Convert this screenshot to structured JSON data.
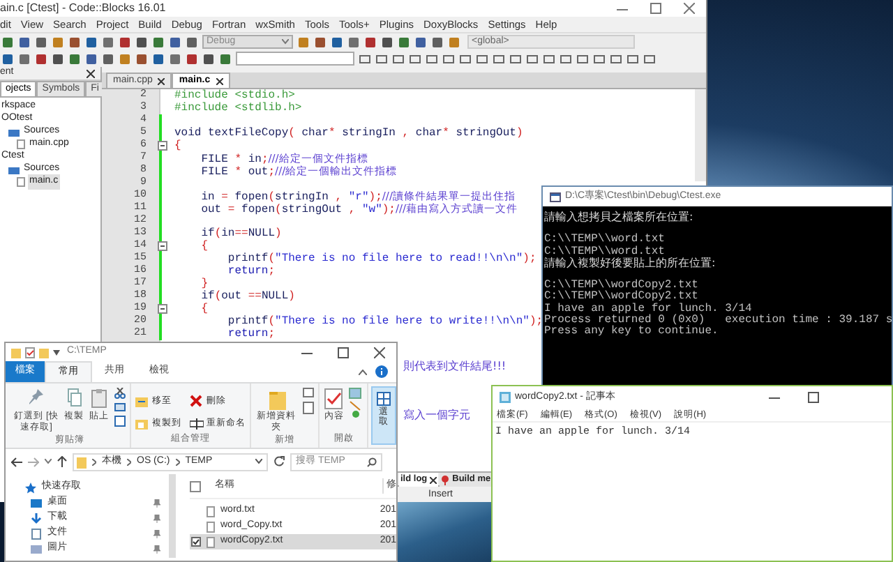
{
  "code_blocks": {
    "title": "ain.c [Ctest] - Code::Blocks 16.01",
    "menu": [
      "dit",
      "View",
      "Search",
      "Project",
      "Build",
      "Debug",
      "Fortran",
      "wxSmith",
      "Tools",
      "Tools+",
      "Plugins",
      "DoxyBlocks",
      "Settings",
      "Help"
    ],
    "build_target": "Debug",
    "scope": "<global>",
    "management": {
      "title": "ent",
      "tabs": [
        {
          "label": "ojects",
          "selected": true
        },
        {
          "label": "Symbols",
          "selected": false
        },
        {
          "label": "Fi",
          "selected": false
        }
      ],
      "tree": [
        {
          "label": "rkspace",
          "children": [
            {
              "label": "OOtest",
              "children": [
                {
                  "label": "Sources",
                  "kind": "folder",
                  "children": [
                    {
                      "label": "main.cpp",
                      "kind": "file",
                      "selected": false
                    }
                  ]
                }
              ]
            },
            {
              "label": "Ctest",
              "children": [
                {
                  "label": "Sources",
                  "kind": "folder",
                  "children": [
                    {
                      "label": "main.c",
                      "kind": "file",
                      "selected": true
                    }
                  ]
                }
              ]
            }
          ]
        }
      ]
    },
    "editor": {
      "tabs": [
        {
          "label": "main.cpp",
          "selected": false
        },
        {
          "label": "main.c",
          "selected": true
        }
      ],
      "lines": [
        {
          "number": "2",
          "fold": false,
          "segments": [
            {
              "kind": "pre",
              "text": "#include <stdio.h>"
            }
          ]
        },
        {
          "number": "3",
          "fold": false,
          "segments": [
            {
              "kind": "pre",
              "text": "#include <stdlib.h>"
            }
          ]
        },
        {
          "number": "4",
          "fold": false
        },
        {
          "number": "5",
          "fold": false,
          "segments": [
            {
              "kind": "code",
              "text": "void textFileCopy"
            },
            {
              "kind": "op",
              "text": "("
            },
            {
              "kind": "code",
              "text": " char"
            },
            {
              "kind": "op",
              "text": "*"
            },
            {
              "kind": "code",
              "text": " stringIn "
            },
            {
              "kind": "op",
              "text": ","
            },
            {
              "kind": "code",
              "text": " char"
            },
            {
              "kind": "op",
              "text": "*"
            },
            {
              "kind": "code",
              "text": " stringOut"
            },
            {
              "kind": "op",
              "text": ")"
            }
          ]
        },
        {
          "number": "6",
          "fold": true,
          "segments": [
            {
              "kind": "op",
              "text": "{"
            }
          ]
        },
        {
          "number": "7",
          "fold": false,
          "segments": [
            {
              "kind": "code",
              "text": "    FILE "
            },
            {
              "kind": "op",
              "text": "*"
            },
            {
              "kind": "code",
              "text": " in"
            },
            {
              "kind": "op",
              "text": ";"
            },
            {
              "kind": "cmt",
              "text": "///給定一個文件指標"
            }
          ]
        },
        {
          "number": "8",
          "fold": false,
          "segments": [
            {
              "kind": "code",
              "text": "    FILE "
            },
            {
              "kind": "op",
              "text": "*"
            },
            {
              "kind": "code",
              "text": " out"
            },
            {
              "kind": "op",
              "text": ";"
            },
            {
              "kind": "cmt",
              "text": "///給定一個輸出文件指標"
            }
          ]
        },
        {
          "number": "9",
          "fold": false
        },
        {
          "number": "10",
          "fold": false,
          "segments": [
            {
              "kind": "code",
              "text": "    in "
            },
            {
              "kind": "op",
              "text": "="
            },
            {
              "kind": "code",
              "text": " fopen"
            },
            {
              "kind": "op",
              "text": "("
            },
            {
              "kind": "code",
              "text": "stringIn "
            },
            {
              "kind": "op",
              "text": ","
            },
            {
              "kind": "str",
              "text": " \"r\""
            },
            {
              "kind": "op",
              "text": ");"
            },
            {
              "kind": "cmt",
              "text": "///讀條件結果單一提出住指"
            }
          ]
        },
        {
          "number": "11",
          "fold": false,
          "segments": [
            {
              "kind": "code",
              "text": "    out "
            },
            {
              "kind": "op",
              "text": "="
            },
            {
              "kind": "code",
              "text": " fopen"
            },
            {
              "kind": "op",
              "text": "("
            },
            {
              "kind": "code",
              "text": "stringOut "
            },
            {
              "kind": "op",
              "text": ","
            },
            {
              "kind": "str",
              "text": " \"w\""
            },
            {
              "kind": "op",
              "text": ");"
            },
            {
              "kind": "cmt",
              "text": "///藉由寫入方式讀一文件"
            }
          ]
        },
        {
          "number": "12",
          "fold": false
        },
        {
          "number": "13",
          "fold": false,
          "segments": [
            {
              "kind": "code",
              "text": "    if"
            },
            {
              "kind": "op",
              "text": "("
            },
            {
              "kind": "code",
              "text": "in"
            },
            {
              "kind": "op",
              "text": "=="
            },
            {
              "kind": "code",
              "text": "NULL"
            },
            {
              "kind": "op",
              "text": ")"
            }
          ]
        },
        {
          "number": "14",
          "fold": true,
          "segments": [
            {
              "kind": "op",
              "text": "    {"
            }
          ]
        },
        {
          "number": "15",
          "fold": false,
          "segments": [
            {
              "kind": "code",
              "text": "        printf"
            },
            {
              "kind": "op",
              "text": "("
            },
            {
              "kind": "str",
              "text": "\"There is no file here to read!!\\n\\n\""
            },
            {
              "kind": "op",
              "text": ");"
            }
          ]
        },
        {
          "number": "16",
          "fold": false,
          "segments": [
            {
              "kind": "kw",
              "text": "        return"
            },
            {
              "kind": "op",
              "text": ";"
            }
          ]
        },
        {
          "number": "17",
          "fold": false,
          "segments": [
            {
              "kind": "op",
              "text": "    }"
            }
          ]
        },
        {
          "number": "18",
          "fold": false,
          "segments": [
            {
              "kind": "code",
              "text": "    if"
            },
            {
              "kind": "op",
              "text": "("
            },
            {
              "kind": "code",
              "text": "out "
            },
            {
              "kind": "op",
              "text": "=="
            },
            {
              "kind": "code",
              "text": "NULL"
            },
            {
              "kind": "op",
              "text": ")"
            }
          ]
        },
        {
          "number": "19",
          "fold": true,
          "segments": [
            {
              "kind": "op",
              "text": "    {"
            }
          ]
        },
        {
          "number": "20",
          "fold": false,
          "segments": [
            {
              "kind": "code",
              "text": "        printf"
            },
            {
              "kind": "op",
              "text": "("
            },
            {
              "kind": "str",
              "text": "\"There is no file here to write!!\\n\\n\""
            },
            {
              "kind": "op",
              "text": ");"
            }
          ]
        },
        {
          "number": "21",
          "fold": false,
          "segments": [
            {
              "kind": "kw",
              "text": "        return"
            },
            {
              "kind": "op",
              "text": ";"
            }
          ]
        }
      ],
      "fragments": [
        "則代表到文件結尾!!!",
        "寫入一個字元"
      ]
    },
    "log_tabs": [
      {
        "label": "ild log",
        "selected": true
      },
      {
        "label": "Build me",
        "selected": false
      }
    ],
    "status": "Insert"
  },
  "console": {
    "title": "D:\\C專案\\Ctest\\bin\\Debug\\Ctest.exe",
    "blocks": [
      [
        "請輸入想拷貝之檔案所在位置:"
      ],
      [
        "C:\\\\TEMP\\\\word.txt",
        "C:\\\\TEMP\\\\word.txt",
        "請輸入複製好後要貼上的所在位置:"
      ],
      [
        "C:\\\\TEMP\\\\wordCopy2.txt",
        "C:\\\\TEMP\\\\wordCopy2.txt",
        "I have an apple for lunch. 3/14",
        "Process returned 0 (0x0)   execution time : 39.187 s",
        "Press any key to continue."
      ]
    ]
  },
  "explorer": {
    "title": "C:\\TEMP",
    "tabs": [
      {
        "label": "檔案",
        "kind": "file"
      },
      {
        "label": "常用",
        "kind": "tab",
        "selected": true
      },
      {
        "label": "共用",
        "kind": "tab",
        "selected": false
      },
      {
        "label": "檢視",
        "kind": "tab",
        "selected": false
      }
    ],
    "groups": [
      {
        "label": "剪貼簿",
        "buttons": [
          {
            "label": "釘選到 [快速存取]",
            "kind": "pin"
          },
          {
            "label": "複製",
            "kind": "copy"
          },
          {
            "label": "貼上",
            "kind": "paste"
          }
        ]
      },
      {
        "label": "組合管理",
        "buttons": [
          {
            "label": "移至",
            "kind": "move"
          },
          {
            "label": "複製到",
            "kind": "copyto"
          },
          {
            "label": "刪除",
            "kind": "delete"
          },
          {
            "label": "重新命名",
            "kind": "rename"
          }
        ]
      },
      {
        "label": "新增",
        "buttons": [
          {
            "label": "新增資料夾",
            "kind": "folder"
          }
        ]
      },
      {
        "label": "開啟",
        "buttons": [
          {
            "label": "內容",
            "kind": "props"
          }
        ]
      }
    ],
    "select_button": "選取",
    "path": [
      "本機",
      "OS (C:)",
      "TEMP"
    ],
    "search_placeholder": "搜尋 TEMP",
    "nav": [
      "快速存取",
      "桌面",
      "下載",
      "文件",
      "圖片"
    ],
    "all_selected": false,
    "columns": [
      "名稱",
      "修"
    ],
    "files": [
      {
        "name": "word.txt",
        "date": "201",
        "selected": false
      },
      {
        "name": "word_Copy.txt",
        "date": "201",
        "selected": false
      },
      {
        "name": "wordCopy2.txt",
        "date": "201",
        "selected": true
      }
    ]
  },
  "notepad": {
    "title": "wordCopy2.txt - 記事本",
    "menu": [
      "檔案(F)",
      "編輯(E)",
      "格式(O)",
      "檢視(V)",
      "說明(H)"
    ],
    "text": "I have an apple for lunch. 3/14"
  }
}
